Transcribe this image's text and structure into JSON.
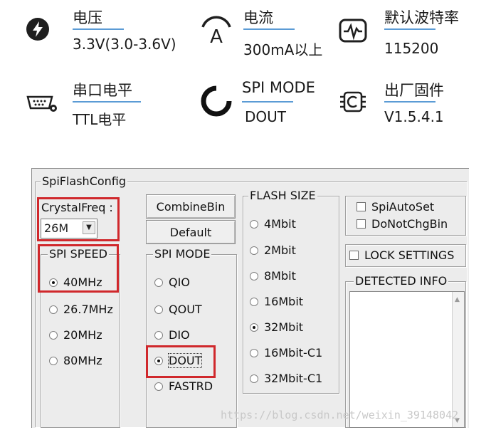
{
  "specs": [
    {
      "label": "电压",
      "value": "3.3V(3.0-3.6V)",
      "icon": "lightning-bolt-icon"
    },
    {
      "label": "电流",
      "value": "300mA以上",
      "icon": "ampere-icon"
    },
    {
      "label": "默认波特率",
      "value": "115200",
      "icon": "waveform-icon"
    },
    {
      "label": "串口电平",
      "value": "TTL电平",
      "icon": "serial-port-icon"
    },
    {
      "label": "SPI MODE",
      "value": "DOUT",
      "icon": "spi-mode-icon"
    },
    {
      "label": "出厂固件",
      "value": "V1.5.4.1",
      "icon": "firmware-chip-icon"
    }
  ],
  "dialog": {
    "title": "SpiFlashConfig",
    "crystal_label": "CrystalFreq :",
    "crystal_value": "26M",
    "spi_speed": {
      "title": "SPI SPEED",
      "options": [
        "40MHz",
        "26.7MHz",
        "20MHz",
        "80MHz"
      ],
      "selected": "40MHz"
    },
    "combine_button": "CombineBin",
    "default_button": "Default",
    "spi_mode": {
      "title": "SPI MODE",
      "options": [
        "QIO",
        "QOUT",
        "DIO",
        "DOUT",
        "FASTRD"
      ],
      "selected": "DOUT"
    },
    "flash_size": {
      "title": "FLASH SIZE",
      "options": [
        "4Mbit",
        "2Mbit",
        "8Mbit",
        "16Mbit",
        "32Mbit",
        "16Mbit-C1",
        "32Mbit-C1"
      ],
      "selected": "32Mbit"
    },
    "spi_auto_set": "SpiAutoSet",
    "do_not_chg_bin": "DoNotChgBin",
    "lock_settings": "LOCK SETTINGS",
    "detected_info": "DETECTED INFO"
  },
  "watermark": "https://blog.csdn.net/weixin_39148042",
  "colors": {
    "highlight": "#d0282c",
    "underline": "#5b9bd5"
  }
}
